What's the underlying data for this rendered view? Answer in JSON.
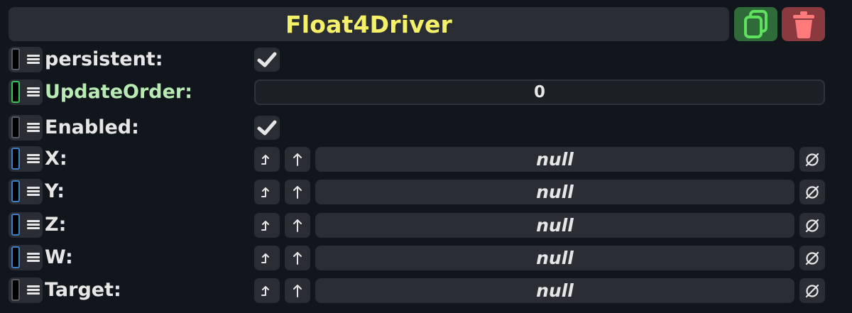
{
  "header": {
    "title": "Float4Driver",
    "title_color": "#f5f06a",
    "duplicate_icon": "duplicate-icon",
    "delete_icon": "trash-icon"
  },
  "fields": [
    {
      "label": "persistent:",
      "type": "checkbox",
      "checked": true
    },
    {
      "label": "UpdateOrder:",
      "type": "number",
      "value": "0"
    },
    {
      "label": "Enabled:",
      "type": "checkbox",
      "checked": true
    },
    {
      "label": "X:",
      "type": "reference",
      "value": "null"
    },
    {
      "label": "Y:",
      "type": "reference",
      "value": "null"
    },
    {
      "label": "Z:",
      "type": "reference",
      "value": "null"
    },
    {
      "label": "W:",
      "type": "reference",
      "value": "null"
    },
    {
      "label": "Target:",
      "type": "reference",
      "value": "null"
    }
  ],
  "colors": {
    "background": "#11151c",
    "button": "#2a2d33",
    "text": "#e6e6e6",
    "duplicate_bg": "#2e6b38",
    "delete_bg": "#8a3a3e"
  }
}
